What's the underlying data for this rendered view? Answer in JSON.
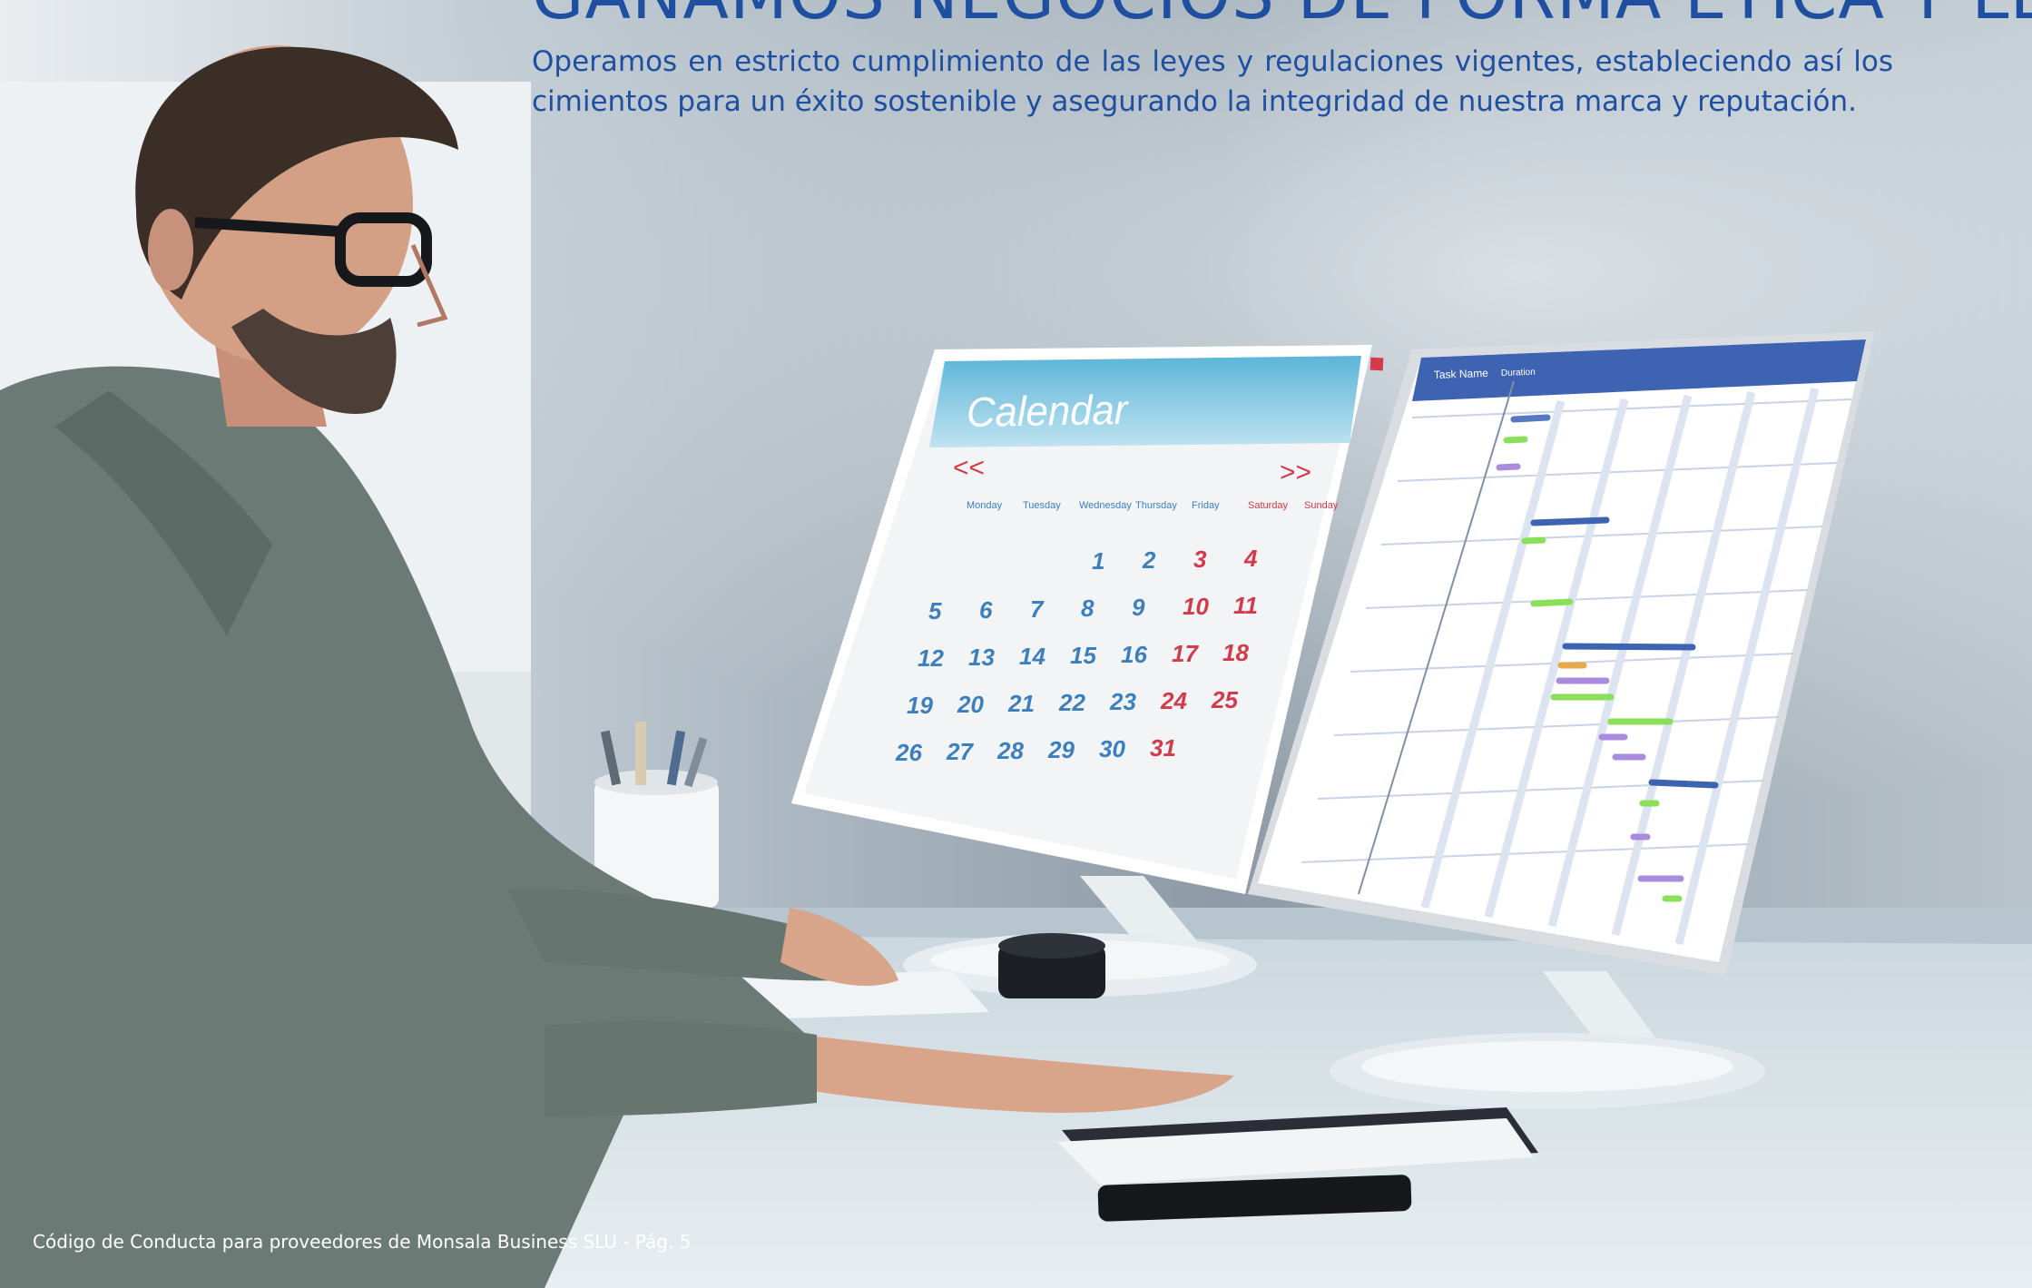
{
  "page": {
    "heading": "GANAMOS NEGOCIOS DE FORMA ÉTICA Y LEGAL",
    "intro": "Operamos en estricto cumplimiento de las leyes y regulaciones vigentes, estableciendo así los cimientos para un éxito sostenible y asegurando la integridad de nuestra marca y reputación.",
    "footer": "Código de Conducta para proveedores de Monsala Business SLU - Pág. 5"
  },
  "photo": {
    "calendar": {
      "title": "Calendar",
      "prev": "<<",
      "next": ">>",
      "weekdays": [
        "Monday",
        "Tuesday",
        "Wednesday",
        "Thursday",
        "Friday",
        "Saturday",
        "Sunday"
      ],
      "weeks": [
        [
          "",
          "",
          "",
          "1",
          "2",
          "3",
          "4"
        ],
        [
          "5",
          "6",
          "7",
          "8",
          "9",
          "10",
          "11"
        ],
        [
          "12",
          "13",
          "14",
          "15",
          "16",
          "17",
          "18"
        ],
        [
          "19",
          "20",
          "21",
          "22",
          "23",
          "24",
          "25"
        ],
        [
          "26",
          "27",
          "28",
          "29",
          "30",
          "31",
          ""
        ]
      ]
    },
    "gantt": {
      "col_task": "Task Name",
      "col_duration": "Duration"
    }
  },
  "colors": {
    "heading_blue": "#1f4fa0",
    "calendar_blue": "#3b7fbf",
    "weekend_red": "#d33a4a",
    "gantt_header": "#3e63b3",
    "gantt_green": "#8be05a",
    "gantt_purple": "#a98be0"
  }
}
